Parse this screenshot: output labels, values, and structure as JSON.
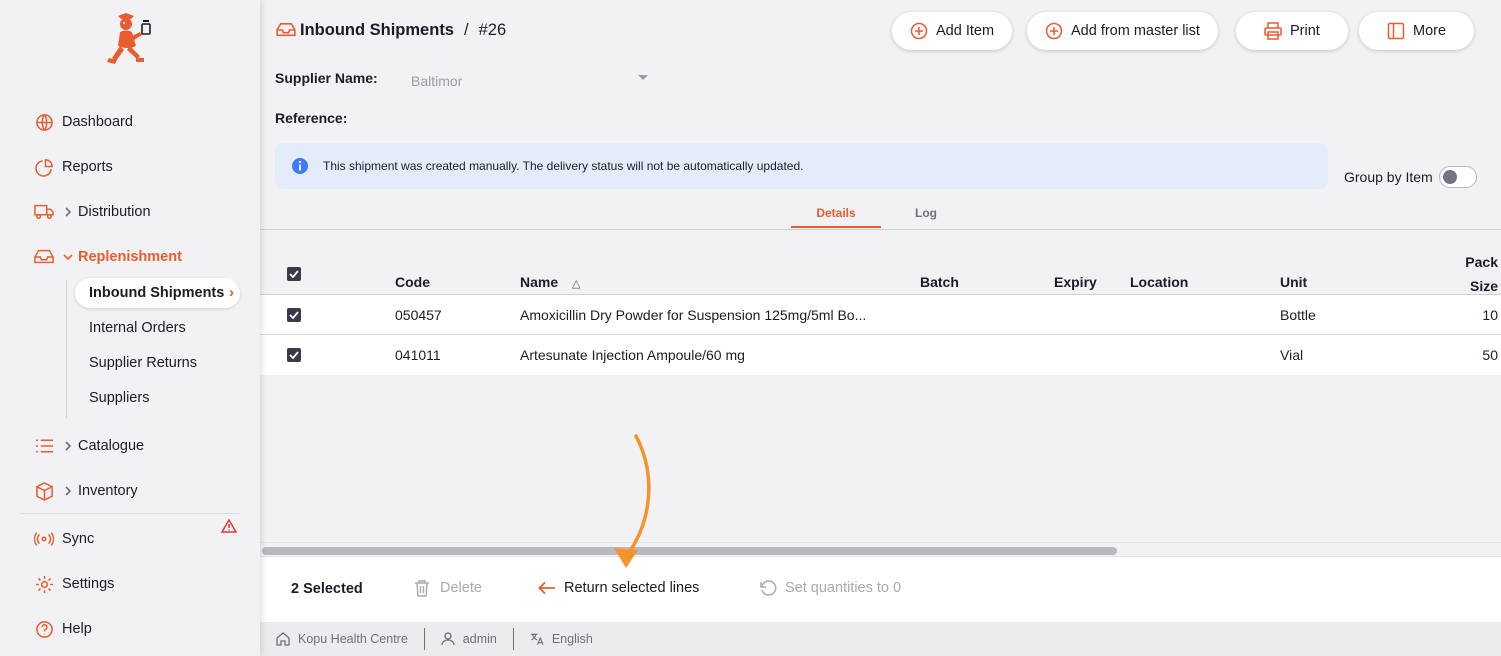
{
  "sidebar": {
    "items": [
      {
        "label": "Dashboard",
        "icon": "globe-icon"
      },
      {
        "label": "Reports",
        "icon": "pie-chart-icon"
      },
      {
        "label": "Distribution",
        "icon": "truck-icon"
      },
      {
        "label": "Replenishment",
        "icon": "inbox-icon"
      },
      {
        "label": "Catalogue",
        "icon": "list-icon"
      },
      {
        "label": "Inventory",
        "icon": "box-icon"
      },
      {
        "label": "Sync",
        "icon": "radio-icon"
      },
      {
        "label": "Settings",
        "icon": "gear-icon"
      },
      {
        "label": "Help",
        "icon": "help-circle-icon"
      }
    ],
    "sub_items": [
      "Inbound Shipments",
      "Internal Orders",
      "Supplier Returns",
      "Suppliers"
    ],
    "active_sub_arrow": "›"
  },
  "header": {
    "breadcrumb_title": "Inbound Shipments",
    "breadcrumb_sep": "/",
    "breadcrumb_number": "#26",
    "buttons": {
      "add_item": "Add Item",
      "add_from_master": "Add from master list",
      "print": "Print",
      "more": "More"
    }
  },
  "form": {
    "supplier_label": "Supplier Name:",
    "supplier_value": "Baltimor",
    "reference_label": "Reference:"
  },
  "info_banner": "This shipment was created manually. The delivery status will not be automatically updated.",
  "group_by_label": "Group by Item",
  "tabs": [
    "Details",
    "Log"
  ],
  "table": {
    "columns": {
      "code": "Code",
      "name": "Name",
      "batch": "Batch",
      "expiry": "Expiry",
      "location": "Location",
      "unit": "Unit",
      "pack_top": "Pack",
      "pack_bottom": "Size"
    },
    "sort_indicator": "△",
    "rows": [
      {
        "code": "050457",
        "name": "Amoxicillin Dry Powder for Suspension 125mg/5ml Bo...",
        "batch": "",
        "expiry": "",
        "location": "",
        "unit": "Bottle",
        "pack_size": "10"
      },
      {
        "code": "041011",
        "name": "Artesunate Injection Ampoule/60 mg",
        "batch": "",
        "expiry": "",
        "location": "",
        "unit": "Vial",
        "pack_size": "50"
      }
    ]
  },
  "actions": {
    "selected": "2 Selected",
    "delete": "Delete",
    "return_lines": "Return selected lines",
    "set_zero": "Set quantities to 0"
  },
  "status_bar": {
    "store": "Kopu Health Centre",
    "user": "admin",
    "language": "English"
  },
  "colors": {
    "accent": "#e95c30",
    "annotation_arrow": "#f5932c",
    "info_bg": "#e4ecfb",
    "info_icon": "#3e7bfa"
  }
}
